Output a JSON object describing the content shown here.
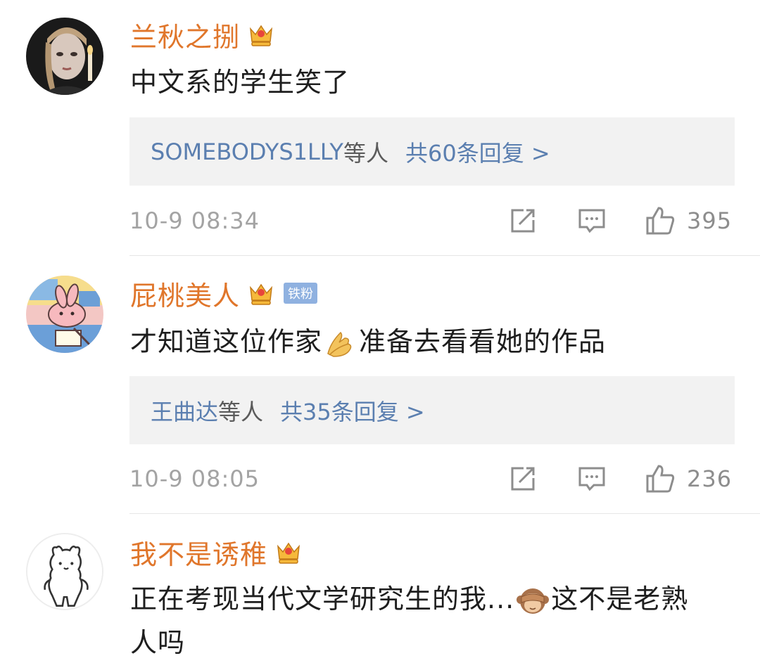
{
  "comments": [
    {
      "username": "兰秋之捌",
      "content": "中文系的学生笑了",
      "reply_users": "SOMEBODYS1LLY",
      "reply_suffix": "等人",
      "reply_count": "共60条回复 >",
      "timestamp": "10-9 08:34",
      "likes": "395"
    },
    {
      "username": "屁桃美人",
      "badge": "铁粉",
      "content_part1": "才知道这位作家",
      "content_part2": "准备去看看她的作品",
      "reply_users": "王曲达",
      "reply_suffix": "等人",
      "reply_count": "共35条回复 >",
      "timestamp": "10-9 08:05",
      "likes": "236"
    },
    {
      "username": "我不是诱稚",
      "content_part1": "正在考现当代文学研究生的我...",
      "content_part2": "这不是老熟人吗"
    }
  ],
  "icons": {
    "crown": "crown-icon",
    "repost": "repost-icon",
    "comment": "comment-icon",
    "like": "thumbs-up-icon",
    "emoji_hands": "folded-hands-emoji",
    "emoji_monkey": "see-no-evil-monkey-emoji"
  },
  "colors": {
    "username": "#e0762b",
    "link": "#5b7fb0",
    "reply_bg": "#f2f2f2",
    "meta": "#a3a3a3",
    "fan_badge": "#8fb1e0"
  }
}
